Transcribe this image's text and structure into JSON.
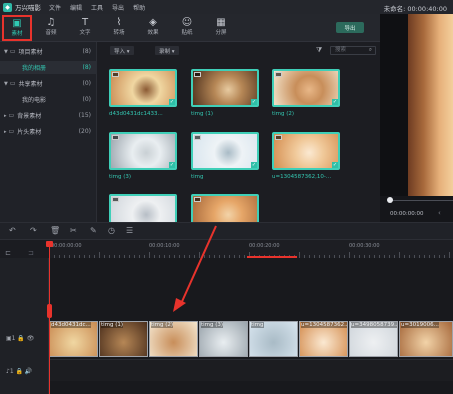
{
  "app": {
    "title": "万兴喵影",
    "project_time": "未命名: 00:00:40:00"
  },
  "menu": [
    "文件",
    "编辑",
    "工具",
    "导出",
    "帮助"
  ],
  "toolbar": [
    {
      "label": "素材",
      "icon": "▣",
      "active": true
    },
    {
      "label": "音频",
      "icon": "♫",
      "active": false
    },
    {
      "label": "文字",
      "icon": "T",
      "active": false
    },
    {
      "label": "转场",
      "icon": "⌇",
      "active": false
    },
    {
      "label": "效果",
      "icon": "◈",
      "active": false
    },
    {
      "label": "贴纸",
      "icon": "☺",
      "active": false
    },
    {
      "label": "分屏",
      "icon": "▦",
      "active": false
    }
  ],
  "export_label": "导出",
  "sidebar": {
    "items": [
      {
        "label": "项目素材",
        "count": "(8)",
        "type": "folder"
      },
      {
        "label": "我的相册",
        "count": "(8)",
        "type": "child",
        "selected": true
      },
      {
        "label": "共享素材",
        "count": "(0)",
        "type": "folder"
      },
      {
        "label": "我的电影",
        "count": "(0)",
        "type": "child"
      },
      {
        "label": "背景素材",
        "count": "(15)",
        "type": "plain"
      },
      {
        "label": "片头素材",
        "count": "(20)",
        "type": "plain"
      }
    ]
  },
  "media_bar": {
    "import_label": "导入",
    "record_label": "录制",
    "search_placeholder": "搜索"
  },
  "media_items": [
    {
      "caption": "d43d0431dc1433...",
      "colors": [
        "#c98a52",
        "#f0d7a2",
        "#8b5a34"
      ]
    },
    {
      "caption": "timg (1)",
      "colors": [
        "#4a2e1c",
        "#b68756",
        "#e7caa0"
      ]
    },
    {
      "caption": "timg (2)",
      "colors": [
        "#f4e6cf",
        "#c88e5a",
        "#e8b788"
      ]
    },
    {
      "caption": "timg (3)",
      "colors": [
        "#9aa4ac",
        "#e9eef1",
        "#c9d0d4"
      ]
    },
    {
      "caption": "timg",
      "colors": [
        "#d7e4ee",
        "#eef3f6",
        "#a9bbc6"
      ]
    },
    {
      "caption": "u=1304587362,10-...",
      "colors": [
        "#d38b4d",
        "#f0c99a",
        "#fbe9d2"
      ]
    },
    {
      "caption": "",
      "colors": [
        "#cfd5db",
        "#eef0f2",
        "#b7bec6"
      ]
    },
    {
      "caption": "",
      "colors": [
        "#a5673a",
        "#e6a668",
        "#f2d3a8"
      ]
    }
  ],
  "preview": {
    "time": "00:00:00:00"
  },
  "ruler": {
    "labels": [
      "00:00:00:00",
      "00:00:10:00",
      "00:00:20:00",
      "00:00:30:00"
    ]
  },
  "track_heads": [
    {
      "label": "▣1  🔒  👁"
    },
    {
      "label": "♪1  🔒  🔊"
    }
  ],
  "clips": [
    {
      "label": "d43d0431dc...",
      "colors": [
        "#c98a52",
        "#f0d7a2"
      ]
    },
    {
      "label": "timg (1)",
      "colors": [
        "#4a2e1c",
        "#b68756"
      ]
    },
    {
      "label": "timg (2)",
      "colors": [
        "#f4e6cf",
        "#c88e5a"
      ]
    },
    {
      "label": "timg (3)",
      "colors": [
        "#9aa4ac",
        "#e9eef1"
      ]
    },
    {
      "label": "timg",
      "colors": [
        "#d7e4ee",
        "#a9bbc6"
      ]
    },
    {
      "label": "u=1304587362...",
      "colors": [
        "#d38b4d",
        "#fbe9d2"
      ]
    },
    {
      "label": "u=3498058739...",
      "colors": [
        "#cfd5db",
        "#eef0f2"
      ]
    },
    {
      "label": "u=3019006...",
      "colors": [
        "#a5673a",
        "#f2d3a8"
      ]
    }
  ]
}
